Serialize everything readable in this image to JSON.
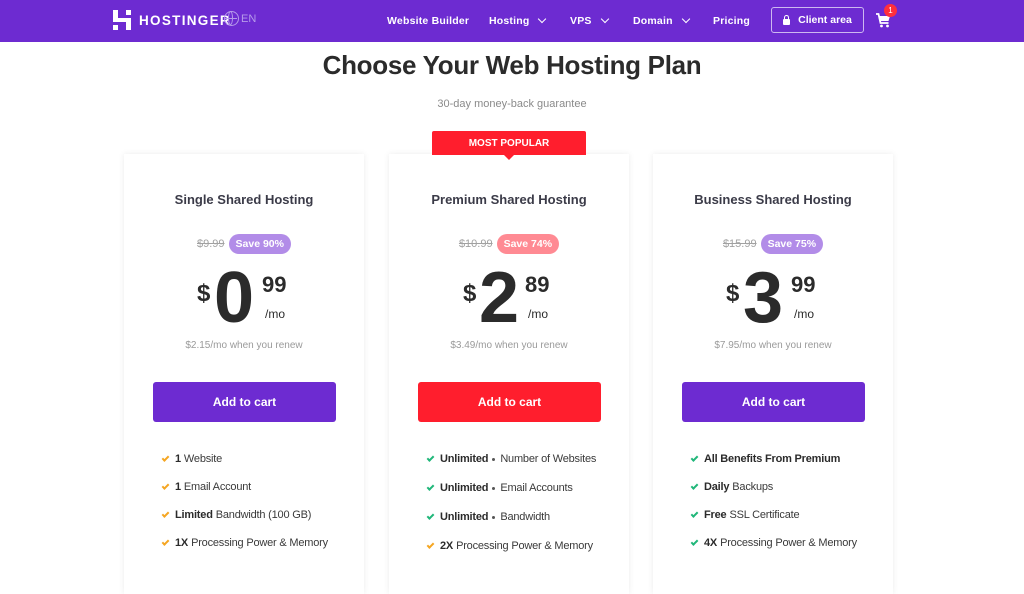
{
  "nav": {
    "brand": "HOSTINGER",
    "language": "EN",
    "items": [
      {
        "label": "Website Builder",
        "dropdown": false
      },
      {
        "label": "Hosting",
        "dropdown": true
      },
      {
        "label": "VPS",
        "dropdown": true
      },
      {
        "label": "Domain",
        "dropdown": true
      },
      {
        "label": "Pricing",
        "dropdown": false
      }
    ],
    "client_area": "Client area",
    "cart_count": "1",
    "colors": {
      "bar": "#6d2bd1",
      "badge": "#ff2f3c"
    }
  },
  "header": {
    "title": "Choose Your Web Hosting Plan",
    "subtitle": "30-day money-back guarantee"
  },
  "ribbon": "MOST POPULAR",
  "plans": [
    {
      "name": "Single Shared Hosting",
      "old_price": "$9.99",
      "save": "Save 90%",
      "save_color": "#b28ce8",
      "currency": "$",
      "whole": "0",
      "cents": "99",
      "per": "/mo",
      "renew": "$2.15/mo when you renew",
      "cta": "Add to cart",
      "cta_color": "#6d2bd1",
      "features": [
        {
          "bold": "1",
          "text": "Website",
          "check": "orange",
          "dot": false
        },
        {
          "bold": "1",
          "text": "Email Account",
          "check": "orange",
          "dot": false
        },
        {
          "bold": "Limited",
          "text": "Bandwidth (100 GB)",
          "check": "orange",
          "dot": false
        },
        {
          "bold": "1X",
          "text": "Processing Power & Memory",
          "check": "orange",
          "dot": false
        }
      ]
    },
    {
      "name": "Premium Shared Hosting",
      "old_price": "$10.99",
      "save": "Save 74%",
      "save_color": "#ff8a93",
      "currency": "$",
      "whole": "2",
      "cents": "89",
      "per": "/mo",
      "renew": "$3.49/mo when you renew",
      "cta": "Add to cart",
      "cta_color": "#ff1e2d",
      "features": [
        {
          "bold": "Unlimited",
          "text": "Number of Websites",
          "check": "green",
          "dot": true
        },
        {
          "bold": "Unlimited",
          "text": "Email Accounts",
          "check": "green",
          "dot": true
        },
        {
          "bold": "Unlimited",
          "text": "Bandwidth",
          "check": "green",
          "dot": true
        },
        {
          "bold": "2X",
          "text": "Processing Power & Memory",
          "check": "orange",
          "dot": false
        }
      ]
    },
    {
      "name": "Business Shared Hosting",
      "old_price": "$15.99",
      "save": "Save 75%",
      "save_color": "#b28ce8",
      "currency": "$",
      "whole": "3",
      "cents": "99",
      "per": "/mo",
      "renew": "$7.95/mo when you renew",
      "cta": "Add to cart",
      "cta_color": "#6d2bd1",
      "features": [
        {
          "bold": "All Benefits From Premium",
          "text": "",
          "check": "green",
          "dot": false
        },
        {
          "bold": "Daily",
          "text": "Backups",
          "check": "green",
          "dot": false
        },
        {
          "bold": "Free",
          "text": "SSL Certificate",
          "check": "green",
          "dot": false
        },
        {
          "bold": "4X",
          "text": "Processing Power & Memory",
          "check": "green",
          "dot": false
        }
      ]
    }
  ],
  "check_colors": {
    "orange": "#f5a623",
    "green": "#21b77a"
  }
}
